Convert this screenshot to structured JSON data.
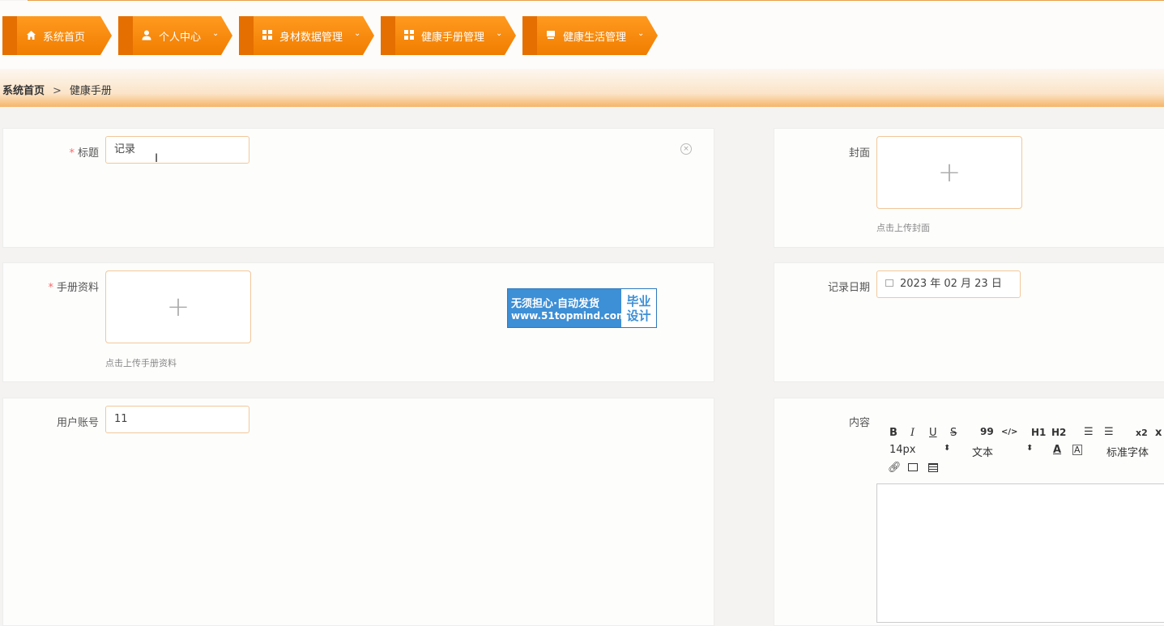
{
  "nav": [
    {
      "label": "系统首页",
      "icon": "home-icon",
      "has_dropdown": false
    },
    {
      "label": "个人中心",
      "icon": "user-icon",
      "has_dropdown": true
    },
    {
      "label": "身材数据管理",
      "icon": "grid-icon",
      "has_dropdown": true
    },
    {
      "label": "健康手册管理",
      "icon": "grid-icon",
      "has_dropdown": true
    },
    {
      "label": "健康生活管理",
      "icon": "book-icon",
      "has_dropdown": true
    }
  ],
  "breadcrumb": {
    "home": "系统首页",
    "separator": ">",
    "current": "健康手册"
  },
  "form": {
    "title_label": "标题",
    "title_value": "记录",
    "cover_label": "封面",
    "cover_hint": "点击上传封面",
    "manual_label": "手册资料",
    "manual_hint": "点击上传手册资料",
    "date_label": "记录日期",
    "date_value": "2023 年 02 月 23 日",
    "account_label": "用户账号",
    "account_value": "11",
    "content_label": "内容"
  },
  "editor": {
    "bold": "B",
    "italic": "I",
    "underline": "U",
    "strike": "S",
    "quote": "99",
    "code": "</>",
    "h1": "H1",
    "h2": "H2",
    "subscript": "x2",
    "close": "x",
    "font_size": "14px",
    "text_type": "文本",
    "font_family": "标准字体"
  },
  "watermark": {
    "line1": "无须担心·自动发货",
    "line2": "www.51topmind.com",
    "right1": "毕业",
    "right2": "设计"
  },
  "colors": {
    "accent": "#f07d00",
    "border": "#f2c79a",
    "required": "#f56c6c"
  }
}
